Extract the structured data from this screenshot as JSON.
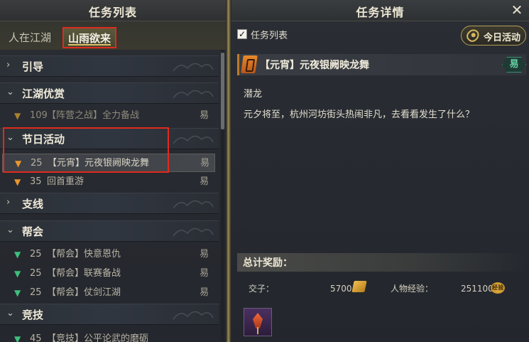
{
  "left_panel": {
    "title": "任务列表",
    "tabs": [
      {
        "label": "人在江湖",
        "active": false
      },
      {
        "label": "山雨欲来",
        "active": true
      }
    ],
    "categories": [
      {
        "label": "引导",
        "expanded": false
      },
      {
        "label": "江湖优赏",
        "expanded": true
      },
      {
        "label": "节日活动",
        "expanded": true
      },
      {
        "label": "支线",
        "expanded": false
      },
      {
        "label": "帮会",
        "expanded": true
      },
      {
        "label": "竞技",
        "expanded": true
      }
    ],
    "quests": [
      {
        "level": "109",
        "name": "【阵营之战】全力备战",
        "difficulty": "易",
        "category": "江湖优赏"
      },
      {
        "level": "25",
        "name": "【元宵】元夜银阙映龙舞",
        "difficulty": "易",
        "category": "节日活动",
        "selected": true
      },
      {
        "level": "35",
        "name": "回首重游",
        "difficulty": "易",
        "category": "节日活动"
      },
      {
        "level": "25",
        "name": "【帮会】快意恩仇",
        "difficulty": "易",
        "category": "帮会"
      },
      {
        "level": "25",
        "name": "【帮会】联赛备战",
        "difficulty": "易",
        "category": "帮会"
      },
      {
        "level": "25",
        "name": "【帮会】仗剑江湖",
        "difficulty": "易",
        "category": "帮会"
      },
      {
        "level": "45",
        "name": "【竞技】公平论武的磨砺",
        "difficulty": "",
        "category": "竞技"
      }
    ]
  },
  "right_panel": {
    "title": "任务详情",
    "close_icon": "close-icon",
    "checkbox_label": "任务列表",
    "checkbox_checked": true,
    "today_button": "今日活动",
    "quest_title": "【元宵】元夜银阙映龙舞",
    "difficulty": "易",
    "subtitle": "潜龙",
    "description": "元夕将至，杭州河坊街头热闹非凡，去看看发生了什么？",
    "reward_header": "总计奖励：",
    "rewards": [
      {
        "label": "交子：",
        "value": "5700",
        "icon": "coin-icon"
      },
      {
        "label": "人物经验：",
        "value": "251100",
        "icon": "exp-icon",
        "icon_text": "经验"
      }
    ]
  },
  "colors": {
    "highlight_box": "#e02a1e",
    "orange_marker": "#e8962e",
    "green_marker": "#3fbf7c",
    "difficulty_badge": "#66d2a4"
  }
}
